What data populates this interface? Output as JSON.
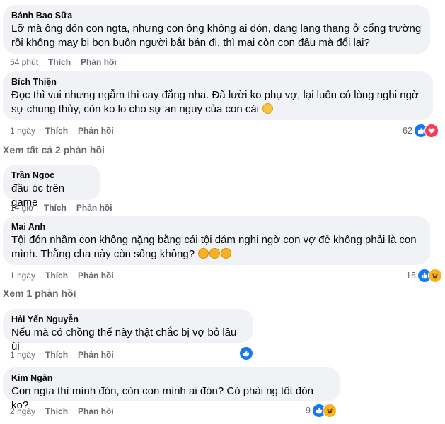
{
  "comments": [
    {
      "author": "Bánh Bao Sữa",
      "text": "Lỡ mà ông đón con ngta, nhưng con ông không ai đón, đang lang thang ở cổng trường rồi không may bị bọn buôn người bắt bán đi, thì mai còn con đâu mà đổi lại?",
      "time": "54 phút",
      "like_label": "Thích",
      "reply_label": "Phản hồi"
    },
    {
      "author": "Bích Thiện",
      "text": "Đọc thì vui nhưng ngẫm thì cay đắng nha. Đã lười ko phụ vợ, lại luôn có lòng nghi ngờ sự chung thủy, còn ko lo cho sự an nguy của con cái",
      "time": "1 ngày",
      "like_label": "Thích",
      "reply_label": "Phản hồi",
      "reaction_count": "62",
      "reactions": [
        "like-icon",
        "love-icon"
      ]
    },
    {
      "author": "Trần Ngọc",
      "text": "đầu óc trên game",
      "time": "14 giờ",
      "like_label": "Thích",
      "reply_label": "Phản hồi"
    },
    {
      "author": "Mai Anh",
      "text": "Tội đón nhầm con không nặng bằng cái tội dám nghi ngờ con vợ đẻ không phải là con mình. Thằng cha này còn sống không?",
      "time": "1 ngày",
      "like_label": "Thích",
      "reply_label": "Phản hồi",
      "reaction_count": "15",
      "reactions": [
        "like-icon",
        "haha-icon"
      ]
    },
    {
      "author": "Hải Yến Nguyễn",
      "text": "Nếu mà có chồng thế này thật chắc bị vợ bỏ lâu ùi",
      "time": "1 ngày",
      "like_label": "Thích",
      "reply_label": "Phản hồi",
      "reactions": [
        "like-icon"
      ]
    },
    {
      "author": "Kim Ngân",
      "text": "Con ngta thì mình đón, còn con mình ai đón? Có phải ng tốt đón ko?",
      "time": "2 ngày",
      "like_label": "Thích",
      "reply_label": "Phản hồi",
      "reaction_count": "9",
      "reactions": [
        "like-icon",
        "haha-icon"
      ]
    }
  ],
  "view_replies": [
    "Xem tất cả 2 phản hồi",
    "Xem 1 phản hồi"
  ],
  "colors": {
    "bubble": "#f0f2f5",
    "muted": "#65676b",
    "like": "#1877f2",
    "love": "#f33e58",
    "haha": "#f7b125"
  }
}
